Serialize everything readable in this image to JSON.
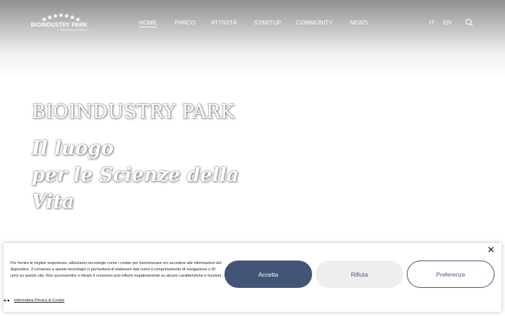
{
  "logo": {
    "title": "BIOINDUSTRY PARK",
    "subtitle": "SPERANZA DI BARTOLO"
  },
  "nav": {
    "items": [
      {
        "label": "HOME",
        "active": true
      },
      {
        "label": "PARCO",
        "active": false
      },
      {
        "label": "ATTIVITÀ",
        "active": false
      },
      {
        "label": "STARTUP",
        "active": false
      },
      {
        "label": "COMMUNITY",
        "active": false
      },
      {
        "label": "NEWS",
        "active": false
      }
    ],
    "languages": [
      "IT",
      "EN"
    ],
    "search_icon": "search-icon"
  },
  "hero": {
    "title": "BIOINDUSTRY PARK",
    "tagline_lines": [
      "Il luogo",
      "per le Scienze della",
      "Vita"
    ]
  },
  "cookie_banner": {
    "text": "Per fornire le migliori esperienze, utilizziamo tecnologie come i cookie per memorizzare e/o accedere alle informazioni del dispositivo. Il consenso a queste tecnologie ci permetterà di elaborare dati come il comportamento di navigazione o ID unici su questo sito. Non acconsentire o ritirare il consenso può influire negativamente su alcune caratteristiche e funzioni.",
    "accept_label": "Accetta",
    "deny_label": "Rifiuta",
    "preferences_label": "Preferenze",
    "privacy_link": "Informativa Privacy & Cookie",
    "close_icon": "close-icon"
  },
  "colors": {
    "accent": "#435576",
    "deny_bg": "#eeeeee",
    "header_gradient_top": "#8f8f8f"
  }
}
